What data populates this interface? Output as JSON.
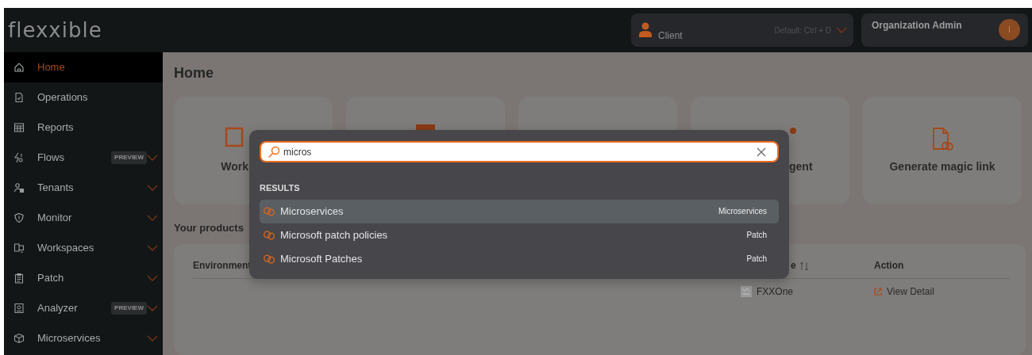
{
  "logo": "flexxible",
  "header": {
    "client": {
      "label": "Client",
      "shortcut": "Default: Ctrl + D"
    },
    "user": {
      "role": "Organization Admin",
      "initial": "I"
    }
  },
  "sidebar": {
    "items": [
      {
        "label": "Home",
        "selected": true,
        "expandable": false
      },
      {
        "label": "Operations",
        "selected": false,
        "expandable": false
      },
      {
        "label": "Reports",
        "selected": false,
        "expandable": false
      },
      {
        "label": "Flows",
        "selected": false,
        "expandable": true,
        "badge": "PREVIEW"
      },
      {
        "label": "Tenants",
        "selected": false,
        "expandable": true
      },
      {
        "label": "Monitor",
        "selected": false,
        "expandable": true
      },
      {
        "label": "Workspaces",
        "selected": false,
        "expandable": true
      },
      {
        "label": "Patch",
        "selected": false,
        "expandable": true
      },
      {
        "label": "Analyzer",
        "selected": false,
        "expandable": true,
        "badge": "PREVIEW"
      },
      {
        "label": "Microservices",
        "selected": false,
        "expandable": true
      }
    ]
  },
  "page": {
    "title": "Home",
    "cards": [
      {
        "kind": "clipped",
        "label": "Work"
      },
      {
        "kind": "blank"
      },
      {
        "kind": "blank"
      },
      {
        "kind": "clipped",
        "label": "gent"
      },
      {
        "kind": "full",
        "label": "Generate magic link"
      }
    ],
    "products": {
      "title": "Your products",
      "columns": [
        {
          "label": "Environment",
          "sortable": false
        },
        {
          "label": "e",
          "sortable": true
        },
        {
          "label": "Action",
          "sortable": false
        }
      ],
      "rows": [
        {
          "column_2": "FXXOne",
          "action": "View Detail"
        }
      ]
    }
  },
  "search": {
    "value": "micros",
    "results_heading": "RESULTS",
    "results": [
      {
        "label": "Microservices",
        "category": "Microservices",
        "selected": true
      },
      {
        "label": "Microsoft patch policies",
        "category": "Patch",
        "selected": false
      },
      {
        "label": "Microsoft Patches",
        "category": "Patch",
        "selected": false
      }
    ]
  }
}
